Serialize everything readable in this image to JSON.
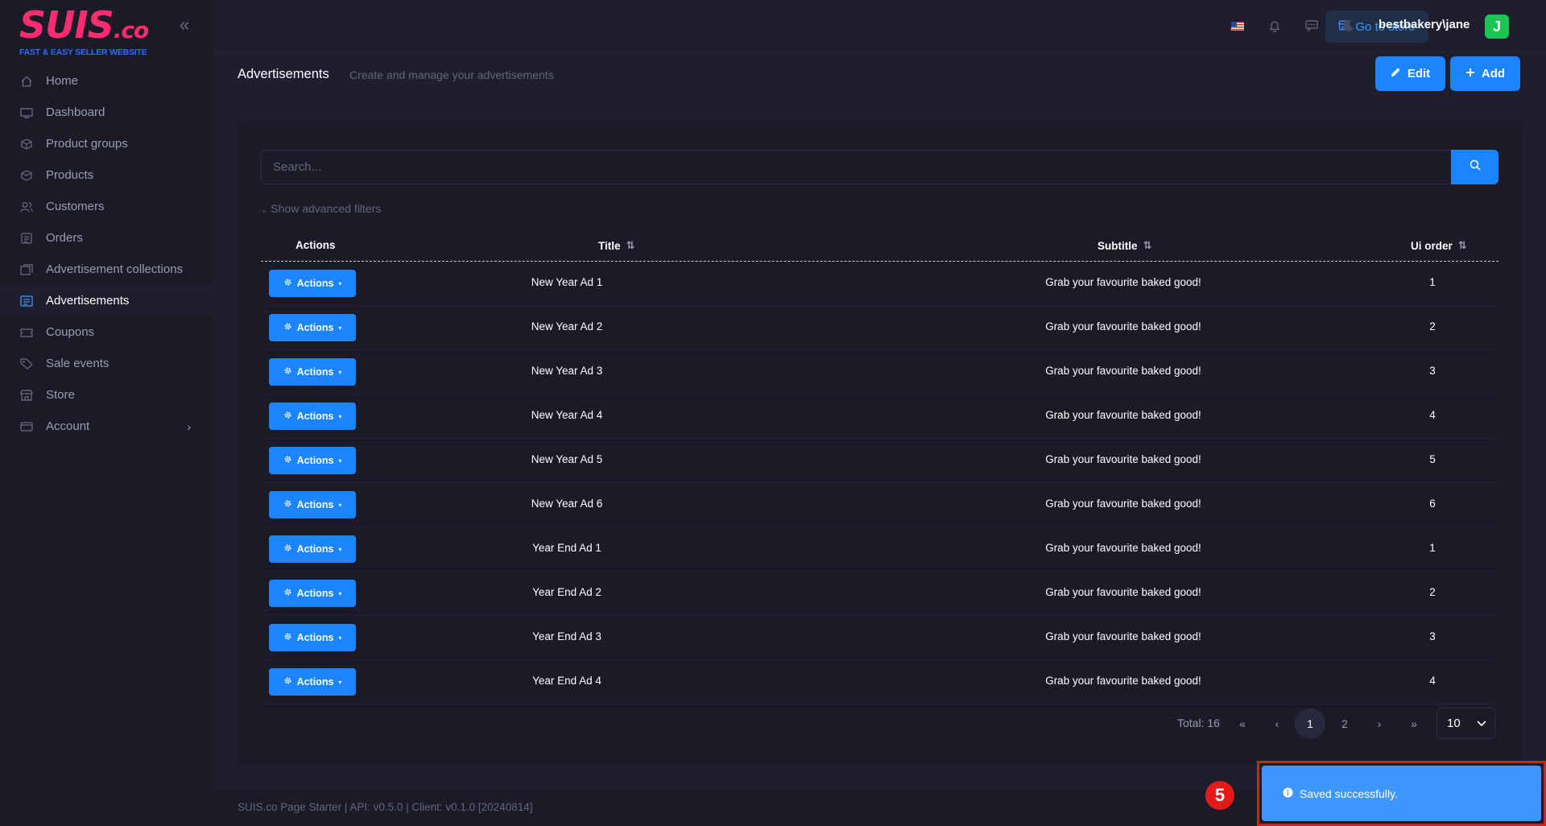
{
  "brand": {
    "logo_text": "SUIS",
    "logo_suffix": ".co",
    "tagline": "FAST & EASY SELLER WEBSITE",
    "logo_color": "#ff2d6f",
    "tagline_color": "#2f6bff"
  },
  "sidebar": {
    "items": [
      {
        "label": "Home",
        "icon": "home-icon"
      },
      {
        "label": "Dashboard",
        "icon": "monitor-icon"
      },
      {
        "label": "Product groups",
        "icon": "cube-icon"
      },
      {
        "label": "Products",
        "icon": "box-icon"
      },
      {
        "label": "Customers",
        "icon": "users-icon"
      },
      {
        "label": "Orders",
        "icon": "list-icon"
      },
      {
        "label": "Advertisement collections",
        "icon": "collection-icon"
      },
      {
        "label": "Advertisements",
        "icon": "ad-icon",
        "active": true
      },
      {
        "label": "Coupons",
        "icon": "ticket-icon"
      },
      {
        "label": "Sale events",
        "icon": "tag-icon"
      },
      {
        "label": "Store",
        "icon": "shop-icon"
      },
      {
        "label": "Account",
        "icon": "account-icon",
        "expandable": true
      }
    ]
  },
  "header": {
    "store_button": "Go to store",
    "user": "bestbakery\\jane",
    "avatar_initial": "J",
    "avatar_color": "#17c653"
  },
  "toolbar": {
    "title": "Advertisements",
    "description": "Create and manage your advertisements",
    "edit_label": "Edit",
    "add_label": "Add"
  },
  "search": {
    "placeholder": "Search...",
    "value": ""
  },
  "filters": {
    "toggle_label": "Show advanced filters"
  },
  "table": {
    "columns": [
      "Actions",
      "Title",
      "Subtitle",
      "Ui order"
    ],
    "action_label": "Actions",
    "rows": [
      {
        "title": "New Year Ad 1",
        "subtitle": "Grab your favourite baked good!",
        "ui_order": "1"
      },
      {
        "title": "New Year Ad 2",
        "subtitle": "Grab your favourite baked good!",
        "ui_order": "2"
      },
      {
        "title": "New Year Ad 3",
        "subtitle": "Grab your favourite baked good!",
        "ui_order": "3"
      },
      {
        "title": "New Year Ad 4",
        "subtitle": "Grab your favourite baked good!",
        "ui_order": "4"
      },
      {
        "title": "New Year Ad 5",
        "subtitle": "Grab your favourite baked good!",
        "ui_order": "5"
      },
      {
        "title": "New Year Ad 6",
        "subtitle": "Grab your favourite baked good!",
        "ui_order": "6"
      },
      {
        "title": "Year End Ad 1",
        "subtitle": "Grab your favourite baked good!",
        "ui_order": "1"
      },
      {
        "title": "Year End Ad 2",
        "subtitle": "Grab your favourite baked good!",
        "ui_order": "2"
      },
      {
        "title": "Year End Ad 3",
        "subtitle": "Grab your favourite baked good!",
        "ui_order": "3"
      },
      {
        "title": "Year End Ad 4",
        "subtitle": "Grab your favourite baked good!",
        "ui_order": "4"
      }
    ]
  },
  "pagination": {
    "total_label": "Total: 16",
    "pages": [
      "1",
      "2"
    ],
    "current_page": "1",
    "page_size": "10"
  },
  "footer": {
    "text": "SUIS.co Page Starter | API: v0.5.0 | Client: v0.1.0 [20240814]"
  },
  "toast": {
    "message": "Saved successfully.",
    "color": "#3e97ff"
  },
  "annotation": {
    "marker": "5"
  },
  "colors": {
    "primary": "#1b84ff",
    "background": "#1e1e2d",
    "panel": "#1b1b28"
  }
}
